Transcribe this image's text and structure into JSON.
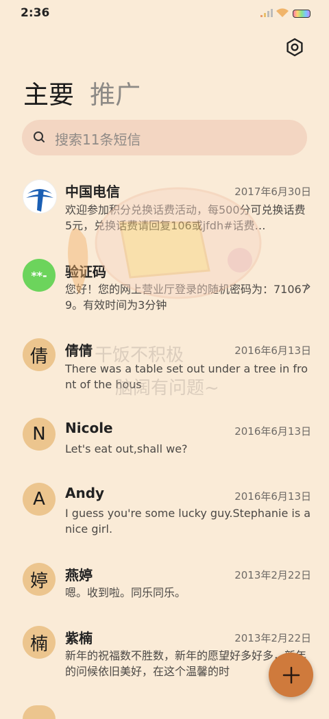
{
  "status_bar": {
    "time": "2:36"
  },
  "tabs": {
    "primary": "主要",
    "promotions": "推广"
  },
  "search": {
    "placeholder": "搜索11条短信"
  },
  "messages": [
    {
      "name": "中国电信",
      "date": "2017年6月30日",
      "preview": "欢迎参加积分兑换话费活动，每500分可兑换话费5元，兑换话费请回复106或jfdh#话费…",
      "avatar": "china-telecom-logo"
    },
    {
      "name": "验证码",
      "date": "",
      "preview": "您好！您的网上营业厅登录的随机密码为：710679。有效时间为3分钟",
      "avatar": "**-"
    },
    {
      "name": "倩倩",
      "date": "2016年6月13日",
      "preview": "There was a table set out under a tree in front of the hous",
      "avatar": "倩"
    },
    {
      "name": "Nicole",
      "date": "2016年6月13日",
      "preview": "Let's eat out,shall we?",
      "avatar": "N"
    },
    {
      "name": "Andy",
      "date": "2016年6月13日",
      "preview": "I guess you're some lucky guy.Stephanie is a nice girl.",
      "avatar": "A"
    },
    {
      "name": "燕婷",
      "date": "2013年2月22日",
      "preview": "嗯。收到啦。同乐同乐。",
      "avatar": "婷"
    },
    {
      "name": "紫楠",
      "date": "2013年2月22日",
      "preview": "新年的祝福数不胜数，新年的愿望好多好多，新年的问候依旧美好，在这个温馨的时",
      "avatar": "楠"
    }
  ],
  "watermark": {
    "line1": "干饭不积极",
    "line2": "脑阔有问题~"
  },
  "colors": {
    "background": "#faebd7",
    "search_bg": "#f3d6c2",
    "avatar_bg": "#ecc58e",
    "fab": "#cf7a3c",
    "verify_avatar": "#6cd45c"
  },
  "icons": {
    "settings": "gear-icon",
    "search": "search-icon",
    "fab": "plus-icon",
    "row_action": "chevron-right-icon"
  }
}
